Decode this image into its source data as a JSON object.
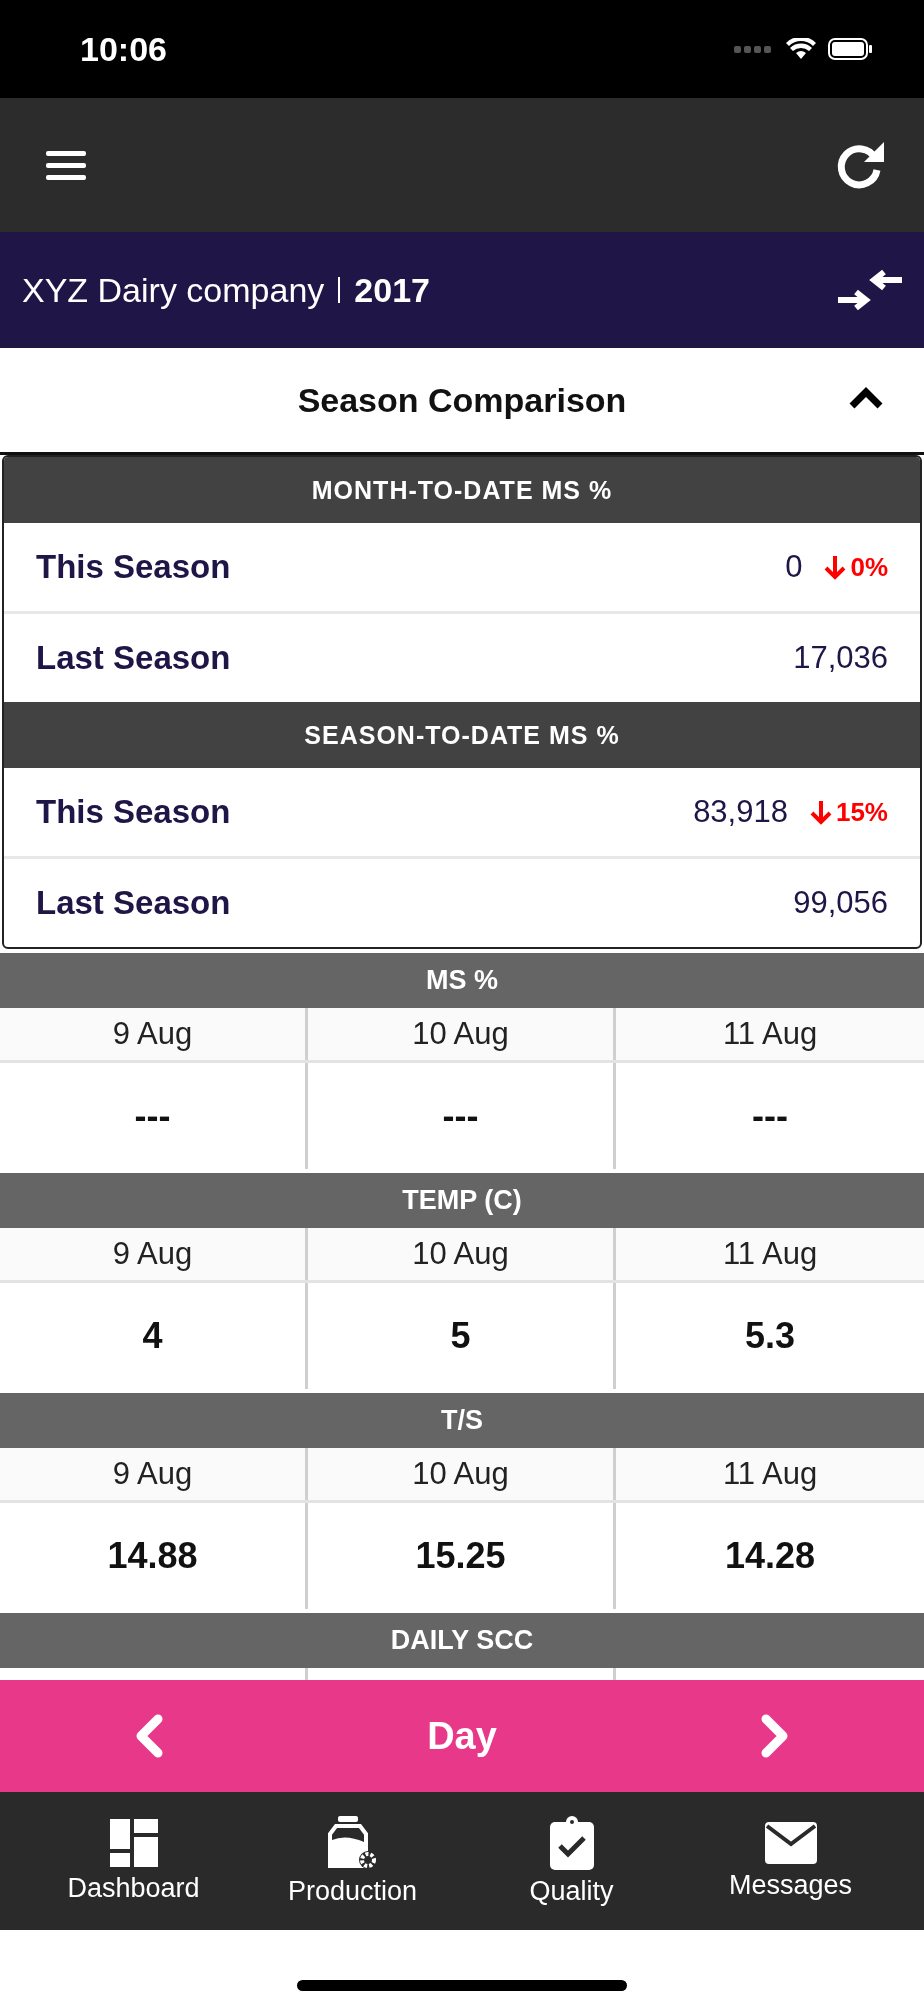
{
  "status_bar": {
    "time": "10:06"
  },
  "company": {
    "name": "XYZ Dairy company",
    "year": "2017"
  },
  "panel": {
    "title": "Season Comparison",
    "expanded": true
  },
  "comparison": [
    {
      "heading": "MONTH-TO-DATE MS %",
      "rows": [
        {
          "label": "This Season",
          "value": "0",
          "trend": {
            "decrease": true,
            "change": "0%"
          }
        },
        {
          "label": "Last Season",
          "value": "17,036"
        }
      ]
    },
    {
      "heading": "SEASON-TO-DATE MS %",
      "rows": [
        {
          "label": "This Season",
          "value": "83,918",
          "trend": {
            "decrease": true,
            "change": "15%"
          }
        },
        {
          "label": "Last Season",
          "value": "99,056"
        }
      ]
    }
  ],
  "metrics": [
    {
      "heading": "MS %",
      "dates": [
        "9 Aug",
        "10 Aug",
        "11 Aug"
      ],
      "values": [
        "---",
        "---",
        "---"
      ]
    },
    {
      "heading": "TEMP (C)",
      "dates": [
        "9 Aug",
        "10 Aug",
        "11 Aug"
      ],
      "values": [
        "4",
        "5",
        "5.3"
      ]
    },
    {
      "heading": "T/S",
      "dates": [
        "9 Aug",
        "10 Aug",
        "11 Aug"
      ],
      "values": [
        "14.88",
        "15.25",
        "14.28"
      ]
    },
    {
      "heading": "DAILY SCC"
    }
  ],
  "period": {
    "label": "Day"
  },
  "tabs": [
    {
      "label": "Dashboard",
      "kind": "dashboard"
    },
    {
      "label": "Production",
      "kind": "production"
    },
    {
      "label": "Quality",
      "kind": "quality"
    },
    {
      "label": "Messages",
      "kind": "messages"
    }
  ]
}
